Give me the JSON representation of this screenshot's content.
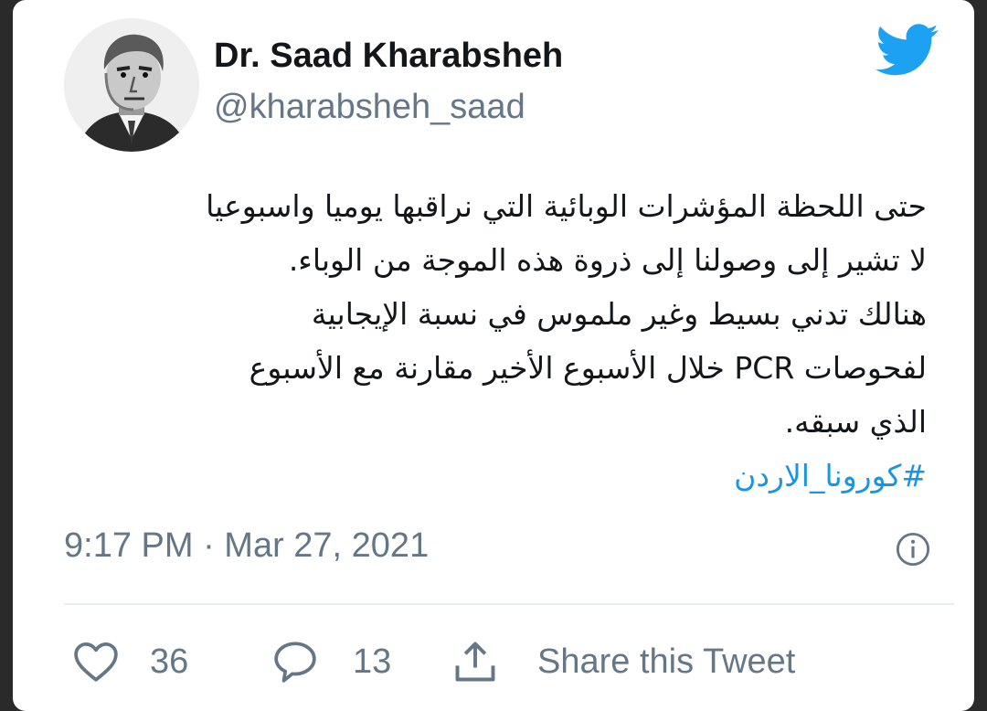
{
  "tweet": {
    "author": {
      "display_name": "Dr. Saad Kharabsheh",
      "handle": "@kharabsheh_saad",
      "avatar_icon": "portrait-sketch",
      "brand_icon": "twitter-bird-icon"
    },
    "text_lines": [
      "حتى اللحظة المؤشرات الوبائية التي نراقبها يوميا واسبوعيا",
      "لا تشير إلى وصولنا إلى ذروة هذه الموجة من الوباء.",
      "هنالك تدني بسيط وغير ملموس في نسبة الإيجابية",
      "لفحوصات PCR خلال الأسبوع الأخير مقارنة مع الأسبوع",
      "الذي سبقه."
    ],
    "hashtag": "#كورونا_الاردن",
    "timestamp": "9:17 PM · Mar 27, 2021",
    "likes": "36",
    "replies": "13",
    "share_label": "Share this Tweet"
  },
  "colors": {
    "brand_blue": "#1da1f2",
    "hashtag_blue": "#1b95e0",
    "secondary_text": "#657786",
    "primary_text": "#14171a"
  }
}
